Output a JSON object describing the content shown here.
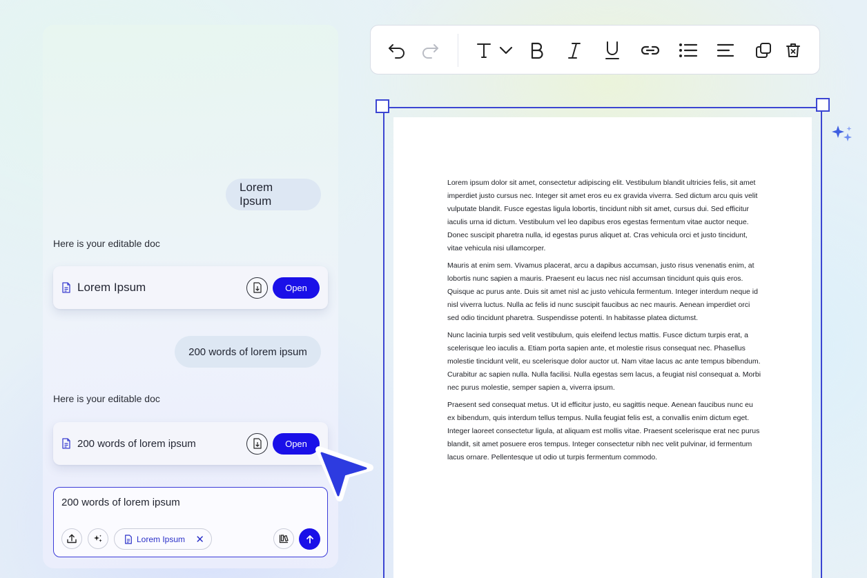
{
  "chat": {
    "messages": [
      {
        "role": "user",
        "text": "Lorem Ipsum"
      },
      {
        "role": "assistant",
        "text": "Here is your editable doc"
      },
      {
        "role": "user",
        "text": "200 words of lorem ipsum"
      },
      {
        "role": "assistant",
        "text": "Here is your editable doc"
      }
    ],
    "doc_cards": [
      {
        "title": "Lorem Ipsum",
        "open_label": "Open",
        "icon": "document-icon",
        "action_icon": "download-icon"
      },
      {
        "title": "200 words of lorem ipsum",
        "open_label": "Open",
        "icon": "document-icon",
        "action_icon": "download-icon"
      }
    ],
    "composer": {
      "value": "200 words of lorem ipsum",
      "attachment_chip": {
        "label": "Lorem Ipsum",
        "remove_glyph": "✕"
      },
      "tools": [
        "upload-icon",
        "sparkle-icon",
        "library-icon",
        "send-icon"
      ]
    }
  },
  "toolbar": {
    "items": [
      "undo-icon",
      "redo-icon",
      "text-format-icon",
      "chevron-down-icon",
      "bold-icon",
      "italic-icon",
      "underline-icon",
      "link-icon",
      "bullet-list-icon",
      "align-left-icon",
      "duplicate-icon",
      "delete-icon"
    ]
  },
  "document": {
    "paragraphs": [
      "Lorem ipsum dolor sit amet, consectetur adipiscing elit. Vestibulum blandit ultricies felis, sit amet imperdiet justo cursus nec. Integer sit amet eros eu ex gravida viverra. Sed dictum arcu quis velit vulputate blandit. Fusce egestas ligula lobortis, tincidunt nibh sit amet, cursus dui. Sed efficitur iaculis urna id dictum. Vestibulum vel leo dapibus eros egestas fermentum vitae auctor neque. Donec suscipit pharetra nulla, id egestas purus aliquet at. Cras vehicula orci et justo tincidunt, vitae vehicula nisi ullamcorper.",
      "Mauris at enim sem. Vivamus placerat, arcu a dapibus accumsan, justo risus venenatis enim, at lobortis nunc sapien a mauris. Praesent eu lacus nec nisl accumsan tincidunt quis quis eros. Quisque ac purus ante. Duis sit amet nisl ac justo vehicula fermentum. Integer interdum neque id nisl viverra luctus. Nulla ac felis id nunc suscipit faucibus ac nec mauris. Aenean imperdiet orci sed odio tincidunt pharetra. Suspendisse potenti. In habitasse platea dictumst.",
      "Nunc lacinia turpis sed velit vestibulum, quis eleifend lectus mattis. Fusce dictum turpis erat, a scelerisque leo iaculis a. Etiam porta sapien ante, et molestie risus consequat nec. Phasellus molestie tincidunt velit, eu scelerisque dolor auctor ut. Nam vitae lacus ac ante tempus bibendum. Curabitur ac sapien nulla. Nulla facilisi. Nulla egestas sem lacus, a feugiat nisl consequat a. Morbi nec purus molestie, semper sapien a, viverra ipsum.",
      "Praesent sed consequat metus. Ut id efficitur justo, eu sagittis neque. Aenean faucibus nunc eu ex bibendum, quis interdum tellus tempus. Nulla feugiat felis est, a convallis enim dictum eget. Integer laoreet consectetur ligula, at aliquam est mollis vitae. Praesent scelerisque erat nec purus blandit, sit amet posuere eros tempus. Integer consectetur nibh nec velit pulvinar, id fermentum lacus ornare. Pellentesque ut odio ut turpis fermentum commodo."
    ]
  },
  "colors": {
    "accent": "#1a10e8",
    "selection": "#3b45d2",
    "bubble": "#dde7f3"
  }
}
